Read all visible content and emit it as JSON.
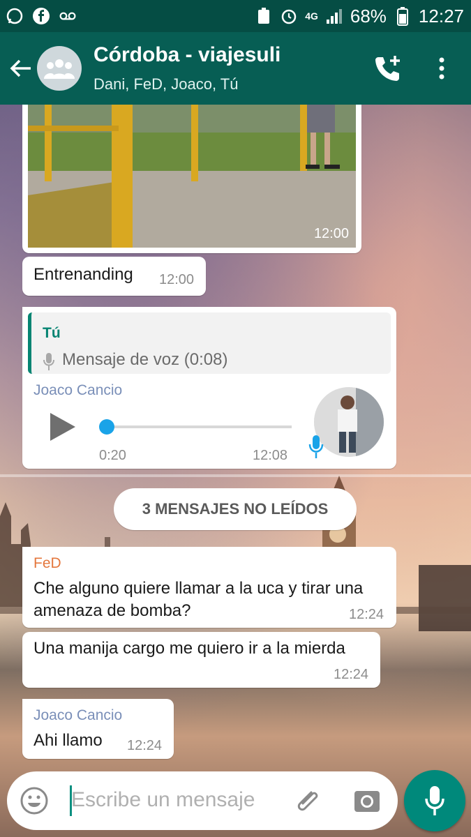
{
  "status_bar": {
    "battery": "68%",
    "time": "12:27",
    "network": "4G"
  },
  "header": {
    "title": "Córdoba - viajesuli",
    "members": "Dani, FeD, Joaco, Tú"
  },
  "messages": {
    "image_time": "12:00",
    "entrenanding": {
      "text": "Entrenanding",
      "time": "12:00"
    },
    "voice_reply": {
      "quote_name": "Tú",
      "quote_text": "Mensaje de voz (0:08)",
      "sender": "Joaco Cancio",
      "elapsed": "0:20",
      "time": "12:08",
      "progress": 0.0
    },
    "unread_divider": "3 MENSAJES NO LEÍDOS",
    "fed_1": {
      "sender": "FeD",
      "line1": "Che alguno quiere llamar a la uca y tirar una",
      "line2": "amenaza de bomba?",
      "time": "12:24"
    },
    "fed_2": {
      "text": "Una manija cargo me quiero ir a la mierda",
      "time": "12:24"
    },
    "joaco": {
      "sender": "Joaco Cancio",
      "text": "Ahi llamo",
      "time": "12:24"
    }
  },
  "composer": {
    "placeholder": "Escribe un mensaje"
  },
  "colors": {
    "header": "#075e54",
    "status_bar": "#054d44",
    "accent": "#00897b",
    "fed": "#e4773d",
    "joaco": "#7a8fb8"
  }
}
